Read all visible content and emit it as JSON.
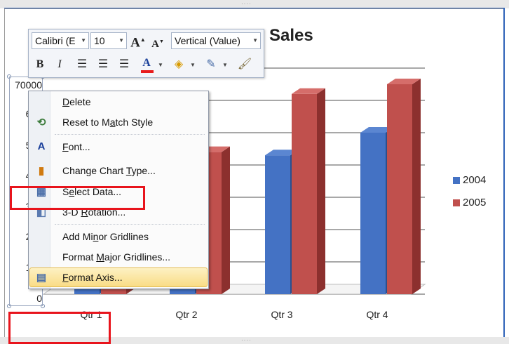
{
  "chart_data": {
    "type": "bar",
    "title": "Sales",
    "categories": [
      "Qtr 1",
      "Qtr 2",
      "Qtr 3",
      "Qtr 4"
    ],
    "series": [
      {
        "name": "2004",
        "values": [
          20000,
          40000,
          43000,
          50000
        ],
        "color": "#4472c4"
      },
      {
        "name": "2005",
        "values": [
          28000,
          44000,
          62000,
          65000
        ],
        "color": "#c0504d"
      }
    ],
    "ylim": [
      0,
      70000
    ],
    "yticks": [
      "0",
      "100",
      "200",
      "300",
      "400",
      "500",
      "600",
      "70000"
    ],
    "grid": true,
    "legend": "right",
    "style": "3-D clustered column"
  },
  "toolbar": {
    "font_name": "Calibri (E",
    "font_size": "10",
    "grow_font": "A",
    "shrink_font": "A",
    "element_selector": "Vertical (Value)",
    "bold": "B",
    "italic": "I"
  },
  "context_menu": {
    "items": [
      {
        "pre": "",
        "u": "D",
        "post": "elete",
        "icon": ""
      },
      {
        "pre": "Reset to M",
        "u": "a",
        "post": "tch Style",
        "icon": "reset-style-icon"
      },
      {
        "pre": "",
        "u": "F",
        "post": "ont...",
        "icon": "font-icon"
      },
      {
        "pre": "Change Chart ",
        "u": "T",
        "post": "ype...",
        "icon": "chart-type-icon"
      },
      {
        "pre": "S",
        "u": "e",
        "post": "lect Data...",
        "icon": "select-data-icon"
      },
      {
        "pre": "3-D ",
        "u": "R",
        "post": "otation...",
        "icon": "rotation-icon"
      },
      {
        "pre": "Add Mi",
        "u": "n",
        "post": "or Gridlines",
        "icon": ""
      },
      {
        "pre": "Format ",
        "u": "M",
        "post": "ajor Gridlines...",
        "icon": ""
      },
      {
        "pre": "",
        "u": "F",
        "post": "ormat Axis...",
        "icon": "format-axis-icon"
      }
    ],
    "highlighted": "Format Axis..."
  },
  "colors": {
    "accent_highlight": "#f9dc86",
    "annotation_red": "#e8141c"
  }
}
